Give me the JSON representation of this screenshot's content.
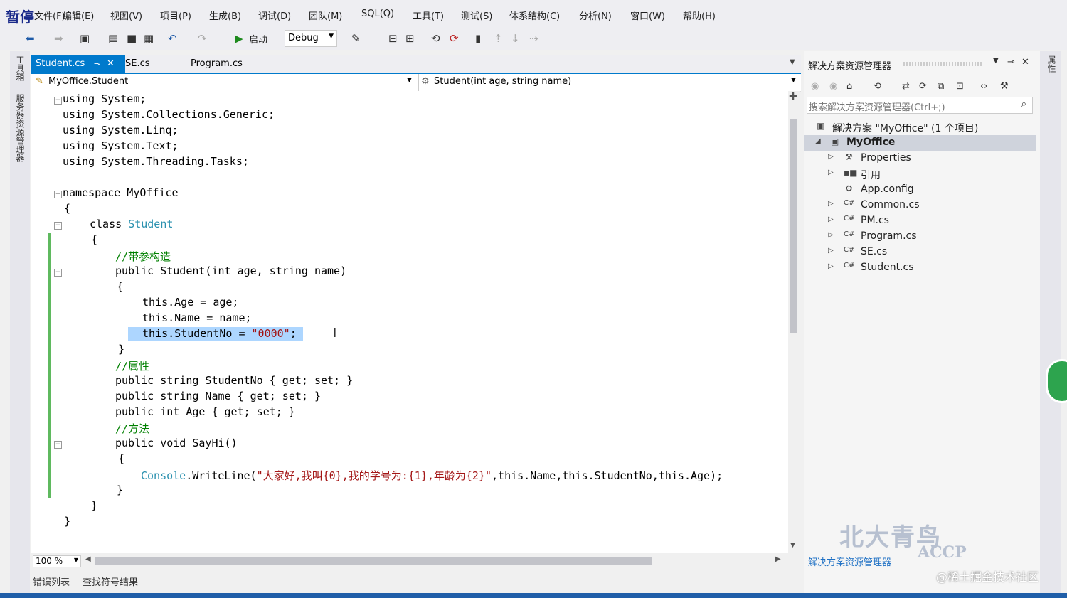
{
  "pause_badge": "暂停",
  "menu": [
    "文件(F)",
    "编辑(E)",
    "视图(V)",
    "项目(P)",
    "生成(B)",
    "调试(D)",
    "团队(M)",
    "SQL(Q)",
    "工具(T)",
    "测试(S)",
    "体系结构(C)",
    "分析(N)",
    "窗口(W)",
    "帮助(H)"
  ],
  "toolbar": {
    "start_label": "启动",
    "config": "Debug"
  },
  "left_strip": {
    "toolbox": "工具箱",
    "server_explorer": "服务器资源管理器"
  },
  "tabs": {
    "active": "Student.cs",
    "second": "SE.cs",
    "third": "Program.cs"
  },
  "navbar": {
    "class_path": "MyOffice.Student",
    "member": "Student(int age, string name)"
  },
  "code": {
    "l1": "using System;",
    "l2": "using System.Collections.Generic;",
    "l3": "using System.Linq;",
    "l4": "using System.Text;",
    "l5": "using System.Threading.Tasks;",
    "l6": "namespace MyOffice",
    "l7": "{",
    "l8_kw": "class",
    "l8_name": "Student",
    "l9": "{",
    "l10": "//带参构造",
    "l11": "public Student(int age, string name)",
    "l12": "{",
    "l13": "this.Age = age;",
    "l14": "this.Name = name;",
    "l15_a": "this.StudentNo = ",
    "l15_b": "\"0000\"",
    "l15_c": ";",
    "l16": "}",
    "l17": "//属性",
    "l18": "public string StudentNo { get; set; }",
    "l19": "public string Name { get; set; }",
    "l20": "public int Age { get; set; }",
    "l21": "//方法",
    "l22": "public void SayHi()",
    "l23": "{",
    "l24_a": "Console",
    "l24_b": ".WriteLine(",
    "l24_c": "\"大家好,我叫{0},我的学号为:{1},年龄为{2}\"",
    "l24_d": ",this.Name,this.StudentNo,this.Age);",
    "l25": "}",
    "l26": "}",
    "l27": "}"
  },
  "zoom": "100 %",
  "bottom_tabs": [
    "错误列表",
    "查找符号结果"
  ],
  "solution_explorer": {
    "title": "解决方案资源管理器",
    "search_placeholder": "搜索解决方案资源管理器(Ctrl+;)",
    "solution": "解决方案 \"MyOffice\" (1 个项目)",
    "project": "MyOffice",
    "items": [
      "Properties",
      "引用",
      "App.config",
      "Common.cs",
      "PM.cs",
      "Program.cs",
      "SE.cs",
      "Student.cs"
    ],
    "footer": "解决方案资源管理器"
  },
  "right_strip": "属性",
  "watermark": {
    "logo": "北大青鸟",
    "accp": "ACCP",
    "site": "@稀土掘金技术社区"
  },
  "colors": {
    "accent": "#007acc",
    "comment": "#008000",
    "string": "#a31515",
    "type": "#2b91af",
    "selection": "#add6ff"
  }
}
